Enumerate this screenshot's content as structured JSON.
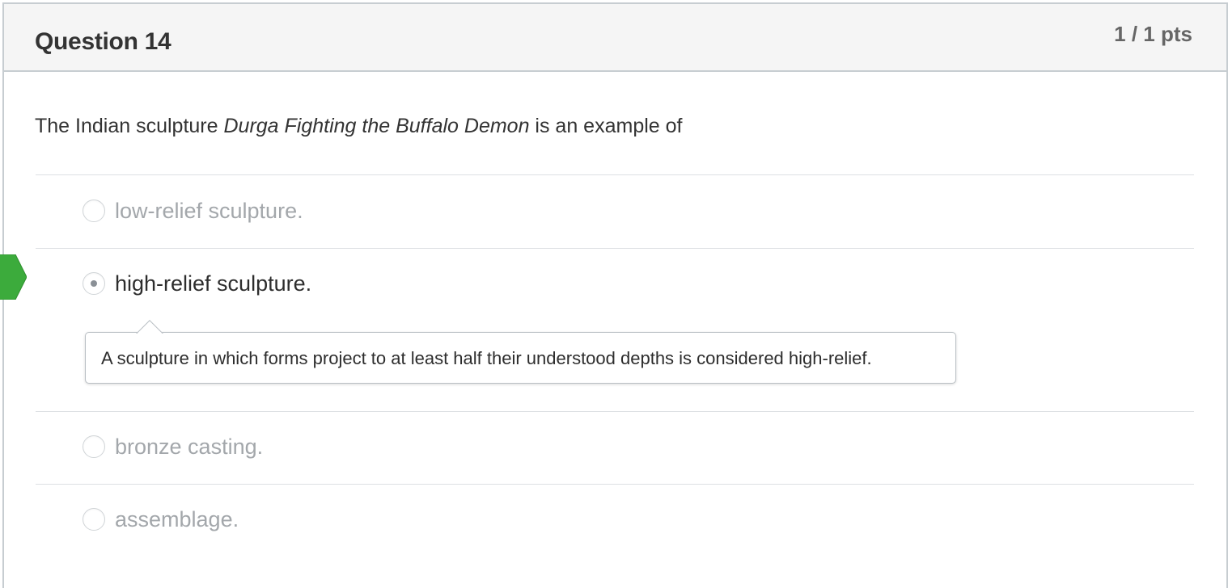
{
  "question": {
    "title": "Question 14",
    "points": "1 / 1 pts",
    "text_before": "The Indian sculpture ",
    "text_italic": "Durga Fighting the Buffalo Demon",
    "text_after": " is an example of"
  },
  "answers": [
    {
      "label": "low-relief sculpture.",
      "selected": false
    },
    {
      "label": "high-relief sculpture.",
      "selected": true,
      "correct": true
    },
    {
      "label": "bronze casting.",
      "selected": false
    },
    {
      "label": "assemblage.",
      "selected": false
    }
  ],
  "feedback": {
    "text": "A sculpture in which forms project to at least half their understood depths is considered high-relief."
  },
  "colors": {
    "correct_flag": "#3cab3c",
    "header_bg": "#f5f5f5",
    "border": "#c7cdd1"
  },
  "icons": {
    "correct_marker": "correct-answer-arrow-icon",
    "radio": "radio-button-icon"
  }
}
